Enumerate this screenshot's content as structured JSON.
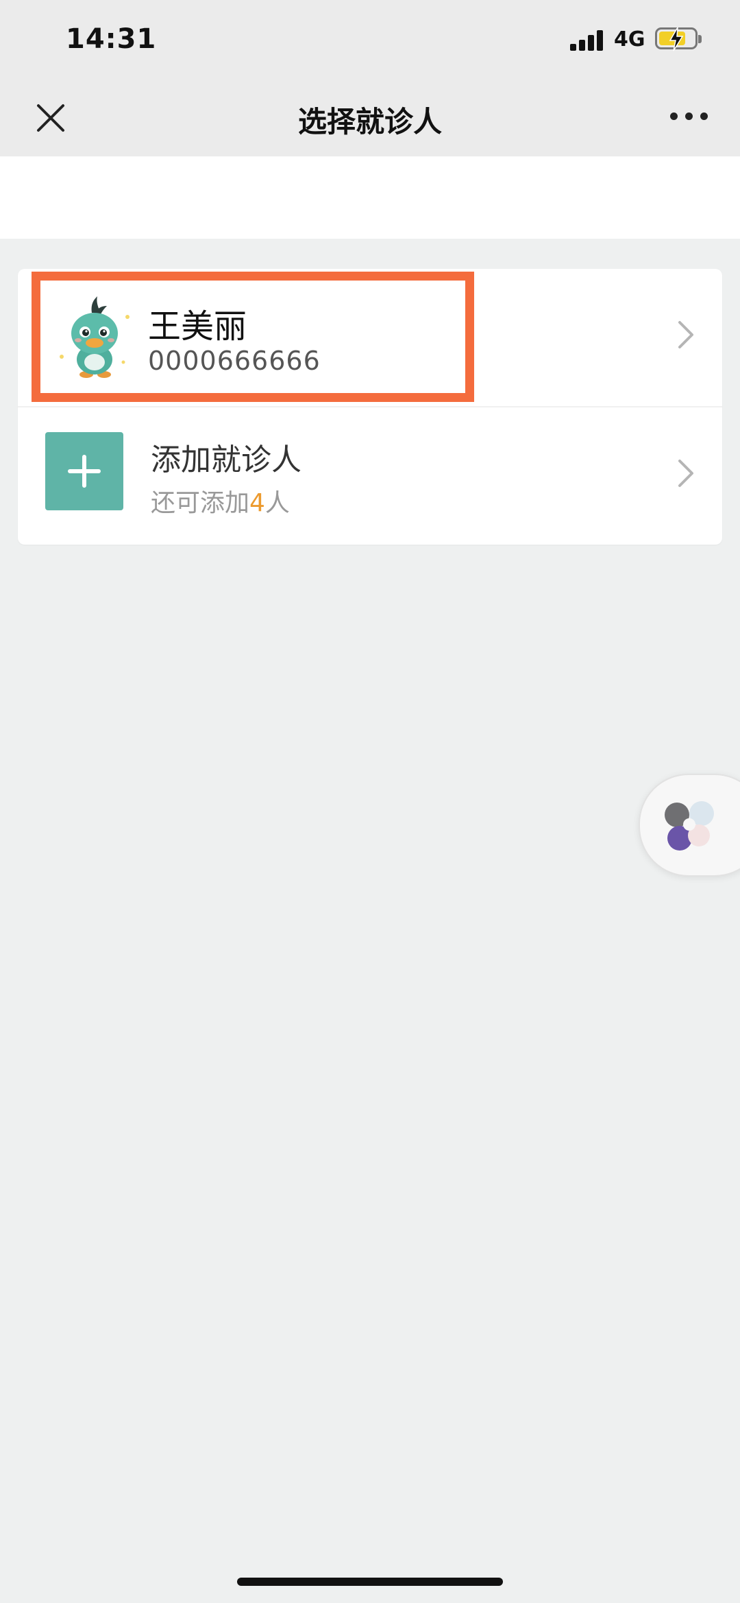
{
  "status_bar": {
    "time": "14:31",
    "network": "4G"
  },
  "nav": {
    "title": "选择就诊人"
  },
  "patients": [
    {
      "name": "王美丽",
      "id": "0000666666"
    }
  ],
  "add_patient": {
    "label": "添加就诊人",
    "remaining_prefix": "还可添加",
    "remaining_count": "4",
    "remaining_suffix": "人"
  },
  "colors": {
    "accent_teal": "#5fb4a7",
    "highlight": "#f46c3d",
    "count_orange": "#ec9a2e"
  },
  "icons": {
    "close": "close-icon",
    "more": "more-icon",
    "chevron": "chevron-right-icon",
    "add": "plus-icon",
    "avatar": "duck-mascot-avatar",
    "float": "floating-assistant-icon"
  }
}
